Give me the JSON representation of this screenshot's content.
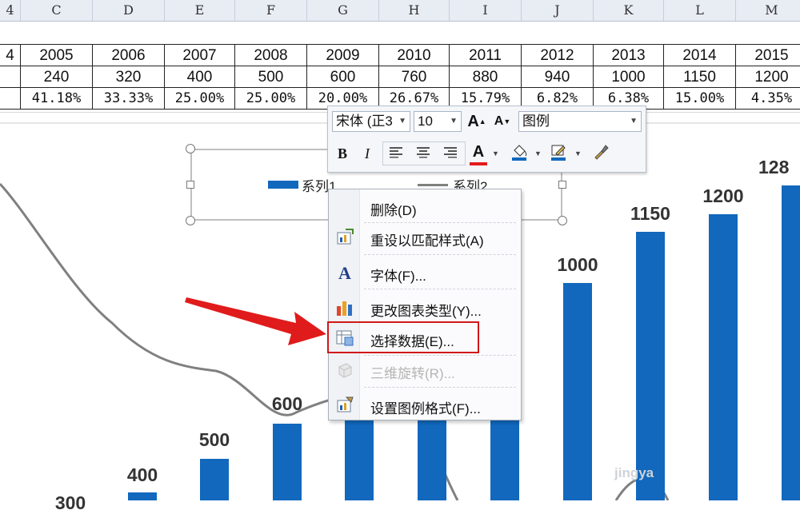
{
  "col_headers": [
    "4",
    "C",
    "D",
    "E",
    "F",
    "G",
    "H",
    "I",
    "J",
    "K",
    "L",
    "M"
  ],
  "table": {
    "row_start_label": "4",
    "years": [
      "2005",
      "2006",
      "2007",
      "2008",
      "2009",
      "2010",
      "2011",
      "2012",
      "2013",
      "2014",
      "2015"
    ],
    "values": [
      "240",
      "320",
      "400",
      "500",
      "600",
      "760",
      "880",
      "940",
      "1000",
      "1150",
      "1200"
    ],
    "percents": [
      "41.18%",
      "33.33%",
      "25.00%",
      "25.00%",
      "20.00%",
      "26.67%",
      "15.79%",
      "6.82%",
      "6.38%",
      "15.00%",
      "4.35%"
    ]
  },
  "chart_data": {
    "type": "bar",
    "bar_labels": [
      "300",
      "400",
      "500",
      "600",
      "1000",
      "1150",
      "1200",
      "128"
    ],
    "series": [
      {
        "name": "系列1",
        "type": "bar",
        "color": "#1168bd"
      },
      {
        "name": "系列2",
        "type": "line",
        "color": "#808080"
      }
    ]
  },
  "legend": {
    "series1": "系列1",
    "series2": "系列2"
  },
  "toolbar": {
    "font_name": "宋体 (正3",
    "font_size": "10",
    "grow_font": "A",
    "shrink_font": "A",
    "element_select": "图例",
    "bold": "B",
    "italic": "I",
    "font_color_glyph": "A"
  },
  "menu": {
    "items": [
      {
        "label": "删除(D)",
        "icon": "none",
        "enabled": true
      },
      {
        "label": "重设以匹配样式(A)",
        "icon": "reset-style-icon",
        "enabled": true
      },
      {
        "label": "字体(F)...",
        "icon": "font-icon",
        "enabled": true
      },
      {
        "label": "更改图表类型(Y)...",
        "icon": "chart-type-icon",
        "enabled": true
      },
      {
        "label": "选择数据(E)...",
        "icon": "select-data-icon",
        "enabled": true
      },
      {
        "label": "三维旋转(R)...",
        "icon": "3d-rotation-icon",
        "enabled": false
      },
      {
        "label": "设置图例格式(F)...",
        "icon": "format-legend-icon",
        "enabled": true
      }
    ]
  },
  "watermark": "jingya",
  "colors": {
    "accent": "#1168bd",
    "highlight": "#d01818",
    "arrow": "#e01b1b",
    "line": "#808080"
  }
}
